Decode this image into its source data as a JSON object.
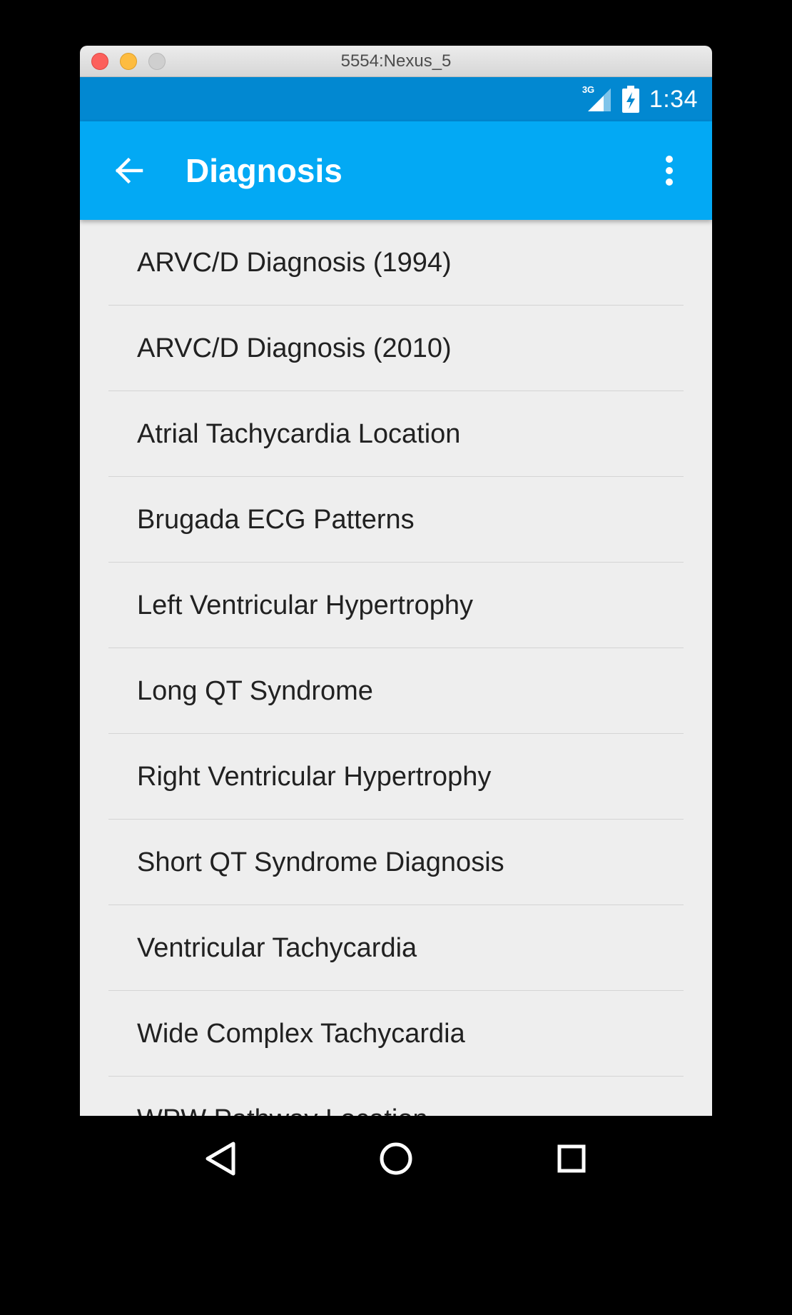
{
  "window": {
    "title": "5554:Nexus_5"
  },
  "status_bar": {
    "network": "3G",
    "time": "1:34"
  },
  "app_bar": {
    "title": "Diagnosis"
  },
  "list": {
    "items": [
      "ARVC/D Diagnosis (1994)",
      "ARVC/D Diagnosis (2010)",
      "Atrial Tachycardia Location",
      "Brugada ECG Patterns",
      "Left Ventricular Hypertrophy",
      "Long QT Syndrome",
      "Right Ventricular Hypertrophy",
      "Short QT Syndrome Diagnosis",
      "Ventricular Tachycardia",
      "Wide Complex Tachycardia",
      "WPW Pathway Location"
    ]
  },
  "colors": {
    "status_bar": "#0288d1",
    "app_bar": "#03a9f4",
    "list_background": "#eeeeee"
  },
  "icons": {
    "back": "arrow-left-icon",
    "overflow": "more-vertical-icon",
    "signal": "signal-icon",
    "battery": "battery-charging-icon",
    "nav_back": "triangle-back-icon",
    "nav_home": "circle-home-icon",
    "nav_recents": "square-recents-icon"
  }
}
